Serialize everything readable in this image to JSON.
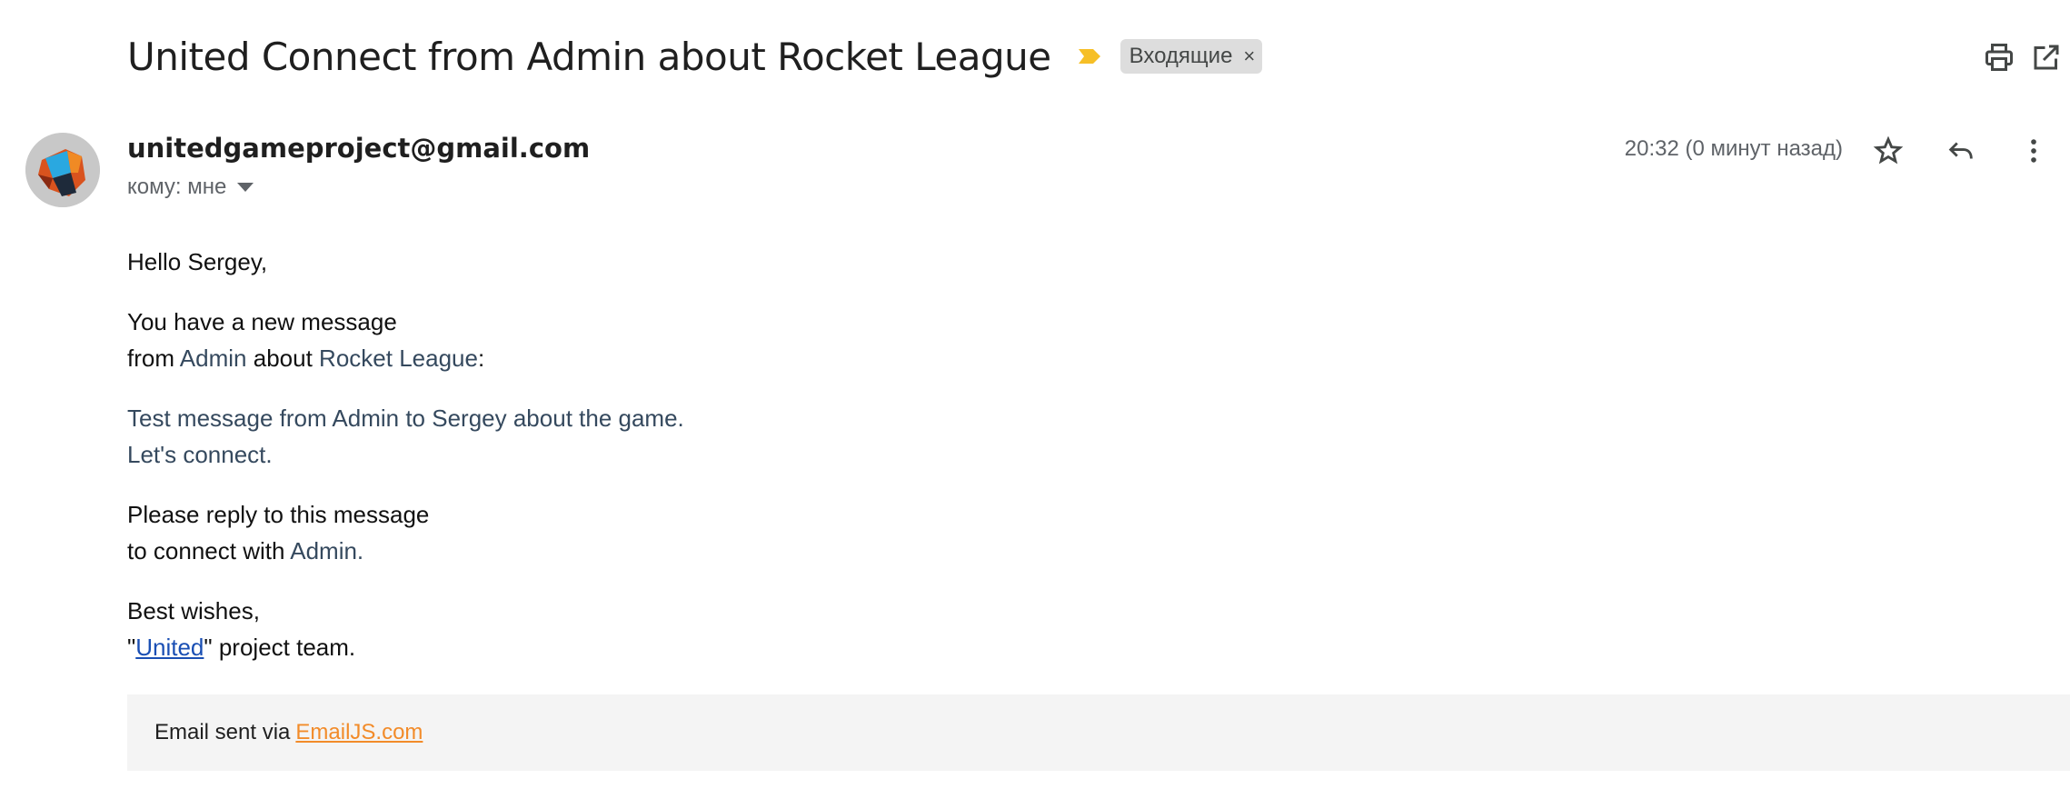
{
  "subject": "United Connect from Admin about Rocket League",
  "label_chip": "Входящие",
  "label_remove": "×",
  "sender_email": "unitedgameproject@gmail.com",
  "recipient_line": "кому: мне",
  "timestamp": "20:32 (0 минут назад)",
  "icons": {
    "importance": "importance-marker-icon",
    "print": "print-icon",
    "open_new_window": "open-in-new-window-icon",
    "star": "star-icon",
    "reply": "reply-icon",
    "more": "more-vert-icon"
  },
  "colors": {
    "importance": "#f6bf26",
    "accent_text": "#35495e",
    "link_blue": "#1a4fb4",
    "link_orange": "#f28b29",
    "footer_bg": "#f4f4f4",
    "chip_bg": "#dddddd"
  },
  "body": {
    "greeting": "Hello Sergey,",
    "line1": "You have a new message",
    "from_prefix": "from",
    "from_name": "Admin",
    "about_word": "about",
    "game_name": "Rocket League",
    "colon": ":",
    "quote_line1": "Test message from Admin to Sergey about the game.",
    "quote_line2": "Let's connect.",
    "reply_line1": "Please reply to this message",
    "reply_line2_prefix": "to connect with",
    "reply_name": "Admin.",
    "sign_line1": "Best wishes,",
    "sign_quote_open": "\"",
    "sign_project": "United",
    "sign_suffix": "\" project team."
  },
  "footer": {
    "text": "Email sent via",
    "link": "EmailJS.com"
  }
}
